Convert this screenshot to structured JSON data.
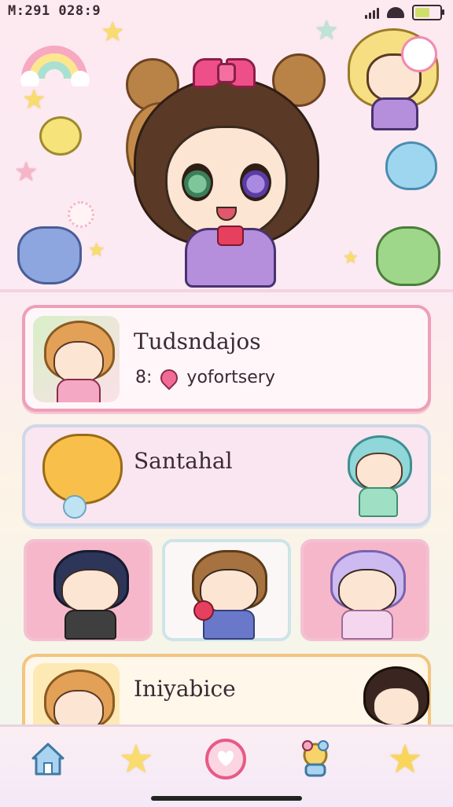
{
  "status": {
    "time": "M:291 028:9",
    "battery_level": 0.7
  },
  "cards": [
    {
      "title": "Tudsndajos",
      "subtitle_prefix": "8:",
      "subtitle": "yofortsery"
    },
    {
      "title": "Santahal"
    },
    {
      "title": "Iniyabice"
    }
  ],
  "nav": {
    "items": [
      {
        "icon": "home-icon"
      },
      {
        "icon": "star-icon"
      },
      {
        "icon": "heart-play-icon"
      },
      {
        "icon": "character-icon"
      },
      {
        "icon": "favorite-star-icon"
      }
    ]
  },
  "colors": {
    "accent_pink": "#ee9fb8",
    "nav_bg": "#fbeef3",
    "card_gold": "#f3c57e"
  }
}
